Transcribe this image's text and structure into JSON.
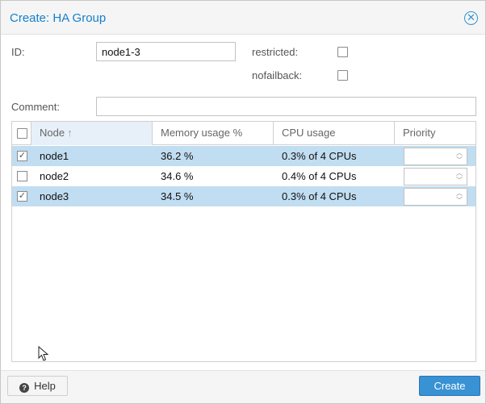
{
  "window": {
    "title": "Create: HA Group",
    "close_icon": "close-circle-icon"
  },
  "form": {
    "id_label": "ID:",
    "id_value": "node1-3",
    "restricted_label": "restricted:",
    "restricted_checked": false,
    "nofailback_label": "nofailback:",
    "nofailback_checked": false,
    "comment_label": "Comment:",
    "comment_value": ""
  },
  "grid": {
    "columns": {
      "node": "Node",
      "memory": "Memory usage %",
      "cpu": "CPU usage",
      "priority": "Priority"
    },
    "sort_icon": "arrow-up-icon",
    "rows": [
      {
        "node": "node1",
        "memory": "36.2 %",
        "cpu": "0.3% of 4 CPUs",
        "priority": "",
        "checked": true
      },
      {
        "node": "node2",
        "memory": "34.6 %",
        "cpu": "0.4% of 4 CPUs",
        "priority": "",
        "checked": false
      },
      {
        "node": "node3",
        "memory": "34.5 %",
        "cpu": "0.3% of 4 CPUs",
        "priority": "",
        "checked": true
      }
    ]
  },
  "footer": {
    "help_label": "Help",
    "create_label": "Create"
  },
  "colors": {
    "accent": "#157fcc",
    "selected_row": "#c1ddf1",
    "primary_button": "#3892d4"
  }
}
